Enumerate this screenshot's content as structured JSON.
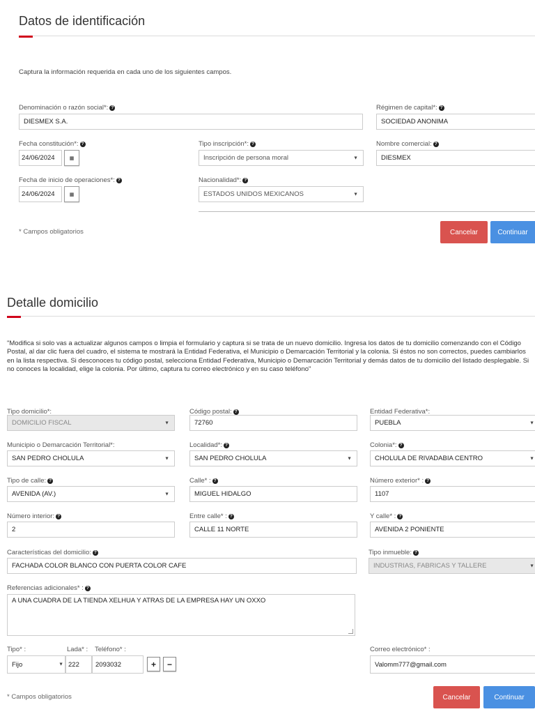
{
  "identificacion": {
    "title": "Datos de identificación",
    "intro": "Captura la información requerida en cada uno de los siguientes campos.",
    "denominacion": {
      "label": "Denominación o razón social*:",
      "value": "DIESMEX S.A."
    },
    "regimen": {
      "label": "Régimen de capital*:",
      "value": "SOCIEDAD ANONIMA"
    },
    "fecha_constitucion": {
      "label": "Fecha constitución*:",
      "value": "24/06/2024"
    },
    "tipo_inscripcion": {
      "label": "Tipo inscripción*:",
      "value": "Inscripción de persona moral"
    },
    "nombre_comercial": {
      "label": "Nombre comercial:",
      "value": "DIESMEX"
    },
    "fecha_inicio": {
      "label": "Fecha de inicio de operaciones*:",
      "value": "24/06/2024"
    },
    "nacionalidad": {
      "label": "Nacionalidad*:",
      "value": "ESTADOS UNIDOS MEXICANOS"
    },
    "required_note": "* Campos obligatorios",
    "cancel": "Cancelar",
    "continue": "Continuar"
  },
  "domicilio": {
    "title": "Detalle domicilio",
    "instructions": "\"Modifica si solo vas a actualizar algunos campos o limpia el formulario y captura si se trata de un nuevo domicilio. Ingresa los datos de tu domicilio comenzando con el Código Postal, al dar clic fuera del cuadro, el sistema te mostrará la Entidad Federativa, el Municipio o Demarcación Territorial y la colonia. Si éstos no son correctos, puedes cambiarlos en la lista respectiva. Si desconoces tu código postal, selecciona Entidad Federativa, Municipio o Demarcación Territorial y demás datos de tu domicilio del listado desplegable. Si no conoces la localidad, elige la colonia. Por último, captura tu correo electrónico y en su caso teléfono\"",
    "tipo_domicilio": {
      "label": "Tipo domicilio*:",
      "value": "DOMICILIO FISCAL"
    },
    "codigo_postal": {
      "label": "Código postal:",
      "value": "72760"
    },
    "entidad": {
      "label": "Entidad Federativa*:",
      "value": "PUEBLA"
    },
    "municipio": {
      "label": "Municipio o Demarcación Territorial*:",
      "value": "SAN PEDRO CHOLULA"
    },
    "localidad": {
      "label": "Localidad*:",
      "value": "SAN PEDRO CHOLULA"
    },
    "colonia": {
      "label": "Colonia*:",
      "value": "CHOLULA DE RIVADABIA CENTRO"
    },
    "tipo_calle": {
      "label": "Tipo de calle:",
      "value": "AVENIDA (AV.)"
    },
    "calle": {
      "label": "Calle* :",
      "value": "MIGUEL HIDALGO"
    },
    "num_exterior": {
      "label": "Número exterior* :",
      "value": "1107"
    },
    "num_interior": {
      "label": "Número interior:",
      "value": "2"
    },
    "entre_calle": {
      "label": "Entre calle* :",
      "value": "CALLE 11 NORTE"
    },
    "y_calle": {
      "label": "Y calle* :",
      "value": "AVENIDA 2 PONIENTE"
    },
    "caracteristicas": {
      "label": "Características del domicilio:",
      "value": "FACHADA COLOR BLANCO CON PUERTA COLOR CAFE"
    },
    "tipo_inmueble": {
      "label": "Tipo inmueble:",
      "value": "INDUSTRIAS, FABRICAS Y TALLERE"
    },
    "referencias": {
      "label": "Referencias adicionales* :",
      "value": "A UNA CUADRA DE LA TIENDA XELHUA Y ATRAS DE LA EMPRESA HAY UN OXXO"
    },
    "tipo_tel": {
      "label": "Tipo* :",
      "value": "Fijo"
    },
    "lada": {
      "label": "Lada* :",
      "value": "222"
    },
    "telefono": {
      "label": "Teléfono* :",
      "value": "2093032"
    },
    "plus": "+",
    "minus": "−",
    "correo": {
      "label": "Correo electrónico* :",
      "value": "Valomm777@gmail.com"
    },
    "required_note": "* Campos obligatorios",
    "cancel": "Cancelar",
    "continue": "Continuar"
  },
  "icons": {
    "help": "question-circle-icon",
    "calendar": "calendar-icon",
    "caret": "caret-down-icon"
  },
  "colors": {
    "accent": "#d0021b",
    "cancel": "#d9534f",
    "continue": "#4a90e2"
  }
}
